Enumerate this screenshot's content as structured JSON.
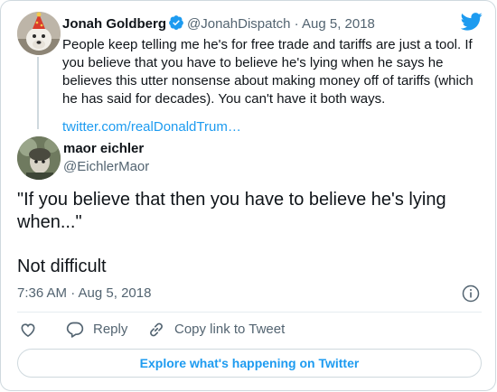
{
  "parent_tweet": {
    "name": "Jonah Goldberg",
    "handle": "@JonahDispatch",
    "separator": "·",
    "date": "Aug 5, 2018",
    "text": "People keep telling me he's for free trade and tariffs are just a tool. If you believe that you have to believe he's lying when he says he believes this utter nonsense about making money off of tariffs (which he has said for decades). You can't have it both ways.",
    "link": "twitter.com/realDonaldTrum…",
    "verified_icon": "verified-badge-icon",
    "avatar_icon": "avatar"
  },
  "tweet": {
    "name": "maor eichler",
    "handle": "@EichlerMaor",
    "text_line1": "\"If you believe that then you have to believe he's lying when...\"",
    "text_line2": "Not difficult",
    "timestamp": "7:36 AM · Aug 5, 2018"
  },
  "actions": {
    "like_icon": "heart-icon",
    "reply_label": "Reply",
    "copy_label": "Copy link to Tweet"
  },
  "explore_label": "Explore what's happening on Twitter",
  "colors": {
    "accent": "#1d9bf0",
    "text": "#0f1419",
    "secondary": "#536471",
    "border": "#cfd9de"
  }
}
